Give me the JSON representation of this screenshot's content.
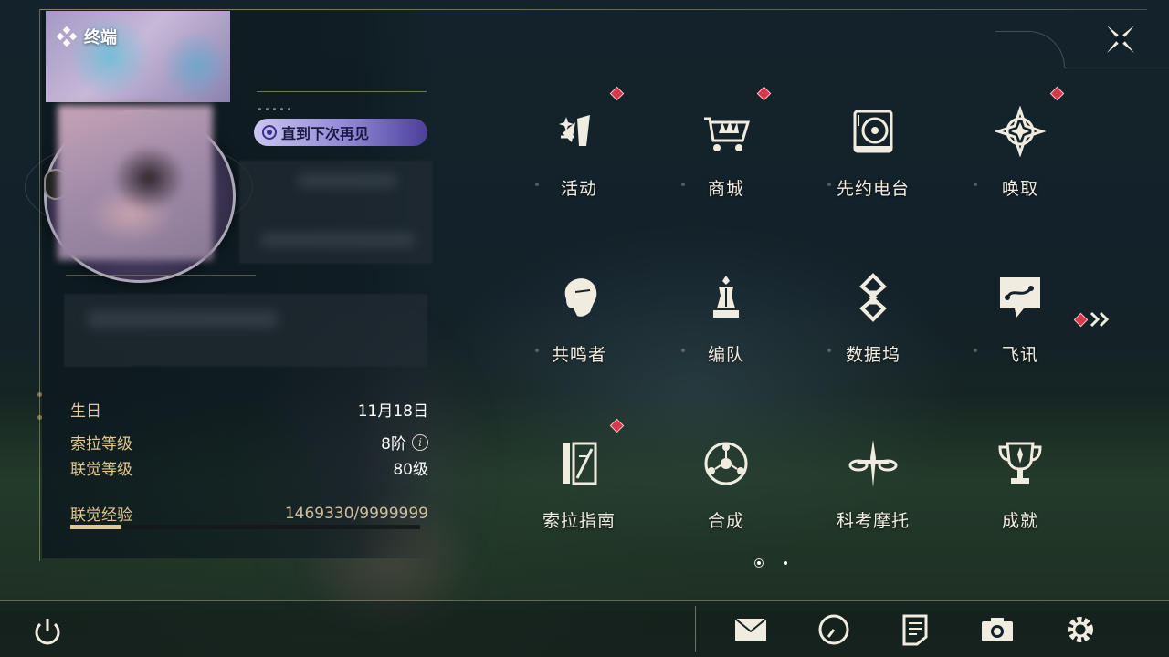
{
  "profile": {
    "terminal_label": "终端",
    "title_badge": "直到下次再见",
    "stats": {
      "birthday_label": "生日",
      "birthday_value": "11月18日",
      "sola_level_label": "索拉等级",
      "sola_level_value": "8阶",
      "union_level_label": "联觉等级",
      "union_level_value": "80级",
      "union_exp_label": "联觉经验",
      "union_exp_value": "1469330/9999999",
      "union_exp_progress": 0.147
    }
  },
  "menu": {
    "items": [
      {
        "label": "活动",
        "icon": "activity-icon",
        "badge": true
      },
      {
        "label": "商城",
        "icon": "shop-cart-icon",
        "badge": true
      },
      {
        "label": "先约电台",
        "icon": "radio-icon",
        "badge": false
      },
      {
        "label": "唤取",
        "icon": "convene-icon",
        "badge": true
      },
      {
        "label": "共鸣者",
        "icon": "resonator-icon",
        "badge": false
      },
      {
        "label": "编队",
        "icon": "team-icon",
        "badge": false
      },
      {
        "label": "数据坞",
        "icon": "data-bank-icon",
        "badge": false
      },
      {
        "label": "飞讯",
        "icon": "message-icon",
        "badge": false
      },
      {
        "label": "索拉指南",
        "icon": "guidebook-icon",
        "badge": true
      },
      {
        "label": "合成",
        "icon": "synthesis-icon",
        "badge": false
      },
      {
        "label": "科考摩托",
        "icon": "motorbike-icon",
        "badge": false
      },
      {
        "label": "成就",
        "icon": "trophy-icon",
        "badge": false
      }
    ],
    "next_page_badge": true,
    "pages": 2,
    "current_page": 1
  },
  "bottom_bar": {
    "icons": [
      "power-icon",
      "mail-icon",
      "clock-icon",
      "notes-icon",
      "camera-icon",
      "settings-gear-icon"
    ]
  },
  "colors": {
    "accent_gold": "#e3c98f",
    "badge_red": "#d9374a",
    "text_light": "#f1ece0",
    "title_badge_purple": "#8e86d5"
  }
}
